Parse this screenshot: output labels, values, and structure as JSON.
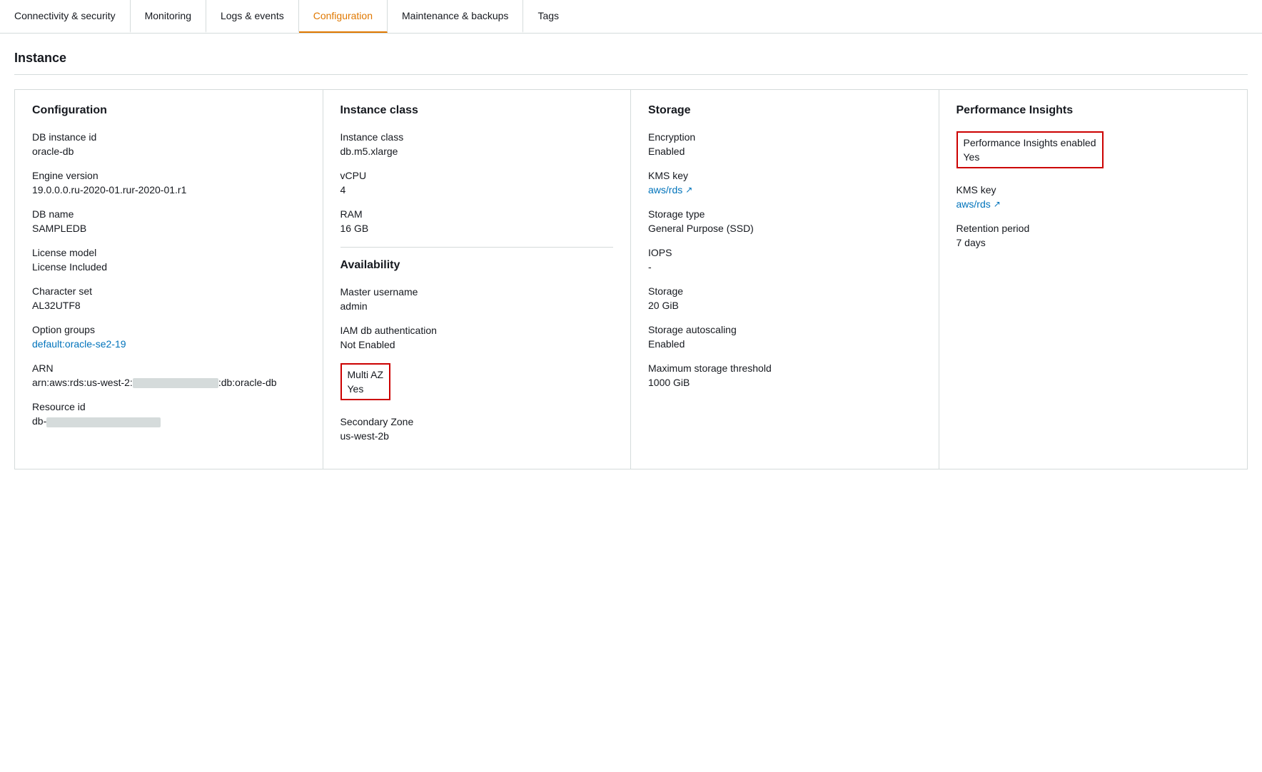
{
  "tabs": [
    {
      "id": "connectivity",
      "label": "Connectivity & security",
      "active": false
    },
    {
      "id": "monitoring",
      "label": "Monitoring",
      "active": false
    },
    {
      "id": "logs",
      "label": "Logs & events",
      "active": false
    },
    {
      "id": "configuration",
      "label": "Configuration",
      "active": true
    },
    {
      "id": "maintenance",
      "label": "Maintenance & backups",
      "active": false
    },
    {
      "id": "tags",
      "label": "Tags",
      "active": false
    }
  ],
  "section": {
    "title": "Instance"
  },
  "columns": {
    "configuration": {
      "title": "Configuration",
      "fields": [
        {
          "label": "DB instance id",
          "value": "oracle-db",
          "type": "text"
        },
        {
          "label": "Engine version",
          "value": "19.0.0.0.ru-2020-01.rur-2020-01.r1",
          "type": "text"
        },
        {
          "label": "DB name",
          "value": "SAMPLEDB",
          "type": "text"
        },
        {
          "label": "License model",
          "value": "License Included",
          "type": "text"
        },
        {
          "label": "Character set",
          "value": "AL32UTF8",
          "type": "text"
        },
        {
          "label": "Option groups",
          "value": "default:oracle-se2-19",
          "type": "link"
        },
        {
          "label": "ARN",
          "value": "arn:aws:rds:us-west-2:",
          "value2": ":db:oracle-db",
          "type": "redacted"
        },
        {
          "label": "Resource id",
          "value": "db-",
          "type": "redacted-short"
        }
      ]
    },
    "instance_class": {
      "title": "Instance class",
      "sub_title": "Availability",
      "fields": [
        {
          "label": "Instance class",
          "value": "db.m5.xlarge",
          "type": "text"
        },
        {
          "label": "vCPU",
          "value": "4",
          "type": "text"
        },
        {
          "label": "RAM",
          "value": "16 GB",
          "type": "text"
        }
      ],
      "availability_fields": [
        {
          "label": "Master username",
          "value": "admin",
          "type": "text"
        },
        {
          "label": "IAM db authentication",
          "value": "Not Enabled",
          "type": "text"
        },
        {
          "label": "Multi AZ",
          "value": "Yes",
          "type": "highlighted"
        },
        {
          "label": "Secondary Zone",
          "value": "us-west-2b",
          "type": "text"
        }
      ]
    },
    "storage": {
      "title": "Storage",
      "fields": [
        {
          "label": "Encryption",
          "value": "Enabled",
          "type": "text"
        },
        {
          "label": "KMS key",
          "value": "aws/rds",
          "type": "link"
        },
        {
          "label": "Storage type",
          "value": "General Purpose (SSD)",
          "type": "text"
        },
        {
          "label": "IOPS",
          "value": "-",
          "type": "text"
        },
        {
          "label": "Storage",
          "value": "20 GiB",
          "type": "text"
        },
        {
          "label": "Storage autoscaling",
          "value": "Enabled",
          "type": "text"
        },
        {
          "label": "Maximum storage threshold",
          "value": "1000 GiB",
          "type": "text"
        }
      ]
    },
    "performance": {
      "title": "Performance Insights",
      "fields": [
        {
          "label": "Performance Insights enabled",
          "value": "Yes",
          "type": "highlighted"
        },
        {
          "label": "KMS key",
          "value": "aws/rds",
          "type": "link"
        },
        {
          "label": "Retention period",
          "value": "7 days",
          "type": "text"
        }
      ]
    }
  },
  "icons": {
    "external_link": "↗"
  }
}
